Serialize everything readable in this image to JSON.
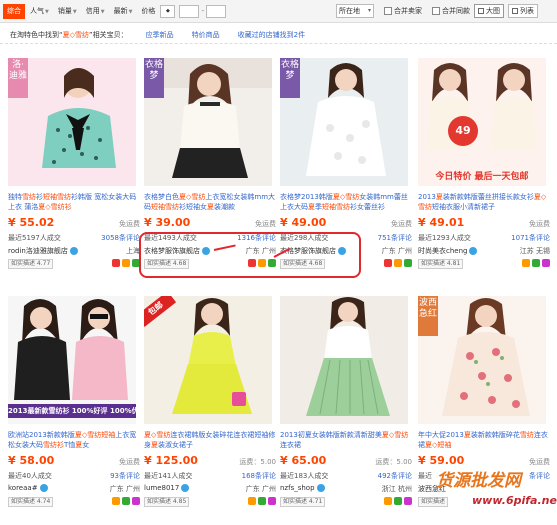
{
  "toolbar": {
    "sorts": [
      "综合",
      "人气",
      "销量",
      "信用",
      "最新",
      "价格"
    ],
    "location": "所在地",
    "merge_seller": "合并卖家",
    "merge_same": "合并同款",
    "view_grid": "大图",
    "view_list": "列表"
  },
  "suggest": {
    "prefix": "在淘特色中找到“",
    "keyword": "夏◇雪纺",
    "suffix": "”相关宝贝：",
    "links": [
      "应季新品",
      "特价商品",
      "收藏过的店铺找到2件"
    ]
  },
  "products": [
    {
      "title_a": "独特",
      "title_hl": "雪纺",
      "title_b": "衫",
      "title_c": "短袖",
      "title_d": "雪纺",
      "title_e": "衫韩版 宽松女装大码上衣 蒲洛",
      "title_f": "夏",
      "title_g": "◇",
      "title_h": "雪纺衫",
      "price": "¥ 55.02",
      "ship": "免运费",
      "sold": "最近5197人成交",
      "reviews": "3058条评论",
      "shop": "rodin洛迪雅旗舰店",
      "city": "上海",
      "dsr": "如实描述 4.77",
      "corner": "洛·迪雅",
      "corner_color": "#e78ab0"
    },
    {
      "title_a": "衣格梦白色",
      "title_hl": "夏",
      "title_b": "◇",
      "title_c": "雪纺",
      "title_d": "上衣宽松女装韩mm大码",
      "title_e": "短袖",
      "title_f": "雪纺",
      "title_g": "衫短袖女",
      "title_h": "夏",
      "title_i": "装潮款",
      "price": "¥ 39.00",
      "ship": "免运费",
      "sold": "最近1493人成交",
      "reviews": "1316条评论",
      "shop": "衣格梦服饰旗舰店",
      "city": "广东 广州",
      "dsr": "如实描述 4.68",
      "corner": "衣格梦",
      "corner_color": "#7a59a8"
    },
    {
      "title_a": "衣格梦2013韩版",
      "title_hl": "夏",
      "title_b": "◇",
      "title_c": "雪纺",
      "title_d": "女装韩mm蕾丝上衣大码",
      "title_e": "夏",
      "title_f": "季",
      "title_g": "短袖",
      "title_h": "雪纺",
      "title_i": "衫女蕾丝衫",
      "price": "¥ 49.00",
      "ship": "免运费",
      "sold": "最近298人成交",
      "reviews": "751条评论",
      "shop": "衣格梦服饰旗舰店",
      "city": "广东 广州",
      "dsr": "如实描述 4.68",
      "corner": "衣格梦",
      "corner_color": "#7a59a8"
    },
    {
      "title_a": "2013",
      "title_hl": "夏",
      "title_b": "装",
      "title_c": "新款",
      "title_d": "韩版",
      "title_e": "蕾丝拼接长款女衫",
      "title_f": "夏",
      "title_g": "◇",
      "title_h": "雪纺",
      "title_i": "短袖",
      "title_j": "衣服小清新裙子",
      "price": "¥ 49.01",
      "ship": "免运费",
      "sold": "最近1293人成交",
      "reviews": "1071条评论",
      "shop": "时尚美衣cheng",
      "city": "江苏 无锡",
      "dsr": "如实描述 4.81",
      "promo_num": "49",
      "promo_text": "今日特价 最后一天包邮"
    },
    {
      "title_a": "欧洲站2013新款韩版",
      "title_hl": "夏",
      "title_b": "◇",
      "title_c": "雪纺",
      "title_d": "短袖",
      "title_e": "上衣宽松女装大码",
      "title_f": "雪纺衫",
      "title_g": "T恤",
      "title_h": "夏",
      "title_i": "女",
      "price": "¥ 58.00",
      "ship": "免运费",
      "sold": "最近40人成交",
      "reviews": "93条评论",
      "shop": "koreaa#",
      "city": "广东 广州",
      "dsr": "如实描述 4.74",
      "banner": "2013最新款雪纺衫 100%好评 100%优质"
    },
    {
      "title_a": "",
      "title_hl": "夏",
      "title_b": "◇",
      "title_c": "雪纺",
      "title_d": "连衣裙",
      "title_e": "韩版女装碎花连衣裙短袖修身",
      "title_f": "夏",
      "title_g": "装",
      "title_h": "淑女裙子",
      "title_i": "",
      "price": "¥ 125.00",
      "ship": "运费：5.00",
      "sold": "最近141人成交",
      "reviews": "168条评论",
      "shop": "lume8017",
      "city": "广东 广州",
      "dsr": "如实描述 4.85",
      "ribbon": "包邮"
    },
    {
      "title_a": "2013初夏女装韩版新款清新甜美",
      "title_hl": "夏",
      "title_b": "◇",
      "title_c": "雪纺",
      "title_d": "",
      "title_e": "连衣裙",
      "title_f": "",
      "title_g": "",
      "title_h": "",
      "title_i": "",
      "price": "¥ 65.00",
      "ship": "运费：5.00",
      "sold": "最近183人成交",
      "reviews": "492条评论",
      "shop": "nzfs_shop",
      "city": "浙江 杭州",
      "dsr": "如实描述 4.71"
    },
    {
      "title_a": "年中大促2013",
      "title_hl": "夏",
      "title_b": "装",
      "title_c": "新款",
      "title_d": "韩版",
      "title_e": "碎花",
      "title_f": "雪纺",
      "title_g": "连衣裙",
      "title_h": "夏",
      "title_i": "◇短袖",
      "price": "¥ 59.00",
      "ship": "免运费",
      "sold": "最近",
      "reviews": "条评论",
      "shop": "波西急红",
      "city": "",
      "dsr": "如实描述",
      "corner": "波西急红",
      "corner_color": "#e07a3a"
    }
  ],
  "annotation": {
    "shop_a": "衣格梦服饰旗舰店",
    "city": "广东 广州",
    "shop_b": "衣格梦服饰旗舰店"
  },
  "watermark": {
    "line1": "货源批发网",
    "line2": "www.6pifa.net"
  }
}
